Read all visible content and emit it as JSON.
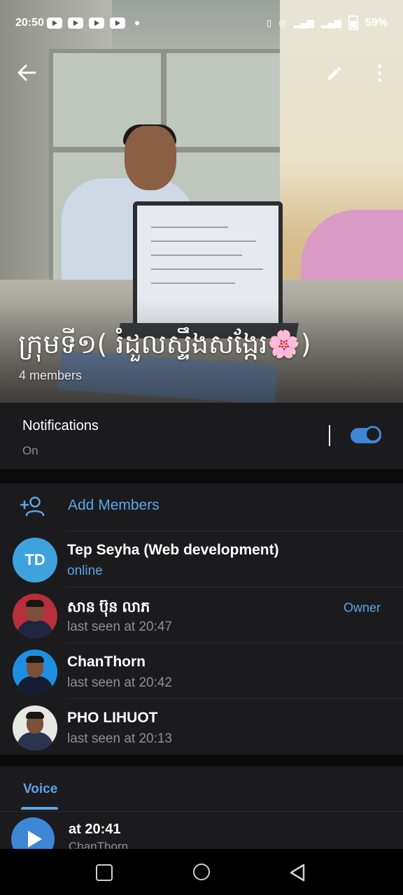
{
  "status_bar": {
    "time": "20:50",
    "battery": "59%"
  },
  "header": {
    "group_name": "ក្រុមទី១( រំដួលស្ទឹងសង្កែរ🌸)",
    "member_count": "4 members"
  },
  "notifications": {
    "label": "Notifications",
    "value": "On",
    "enabled": true
  },
  "members_section": {
    "add_label": "Add Members",
    "members": [
      {
        "initials": "TD",
        "name": "Tep Seyha (Web development)",
        "status": "online",
        "role": ""
      },
      {
        "initials": "",
        "name": "សាន ប៊ុន លាភ",
        "status": "last seen at 20:47",
        "role": "Owner"
      },
      {
        "initials": "",
        "name": "ChanThorn",
        "status": "last seen at 20:42",
        "role": ""
      },
      {
        "initials": "",
        "name": "PHO LIHUOT",
        "status": "last seen at 20:13",
        "role": ""
      }
    ]
  },
  "media_tabs": {
    "active_tab": "Voice"
  },
  "voice_list": [
    {
      "title": "at 20:41",
      "sender": "ChanThorn"
    }
  ],
  "colors": {
    "accent": "#5aa5e8",
    "background": "#1b1b1d",
    "avatar_td": "#3ea3dc"
  }
}
